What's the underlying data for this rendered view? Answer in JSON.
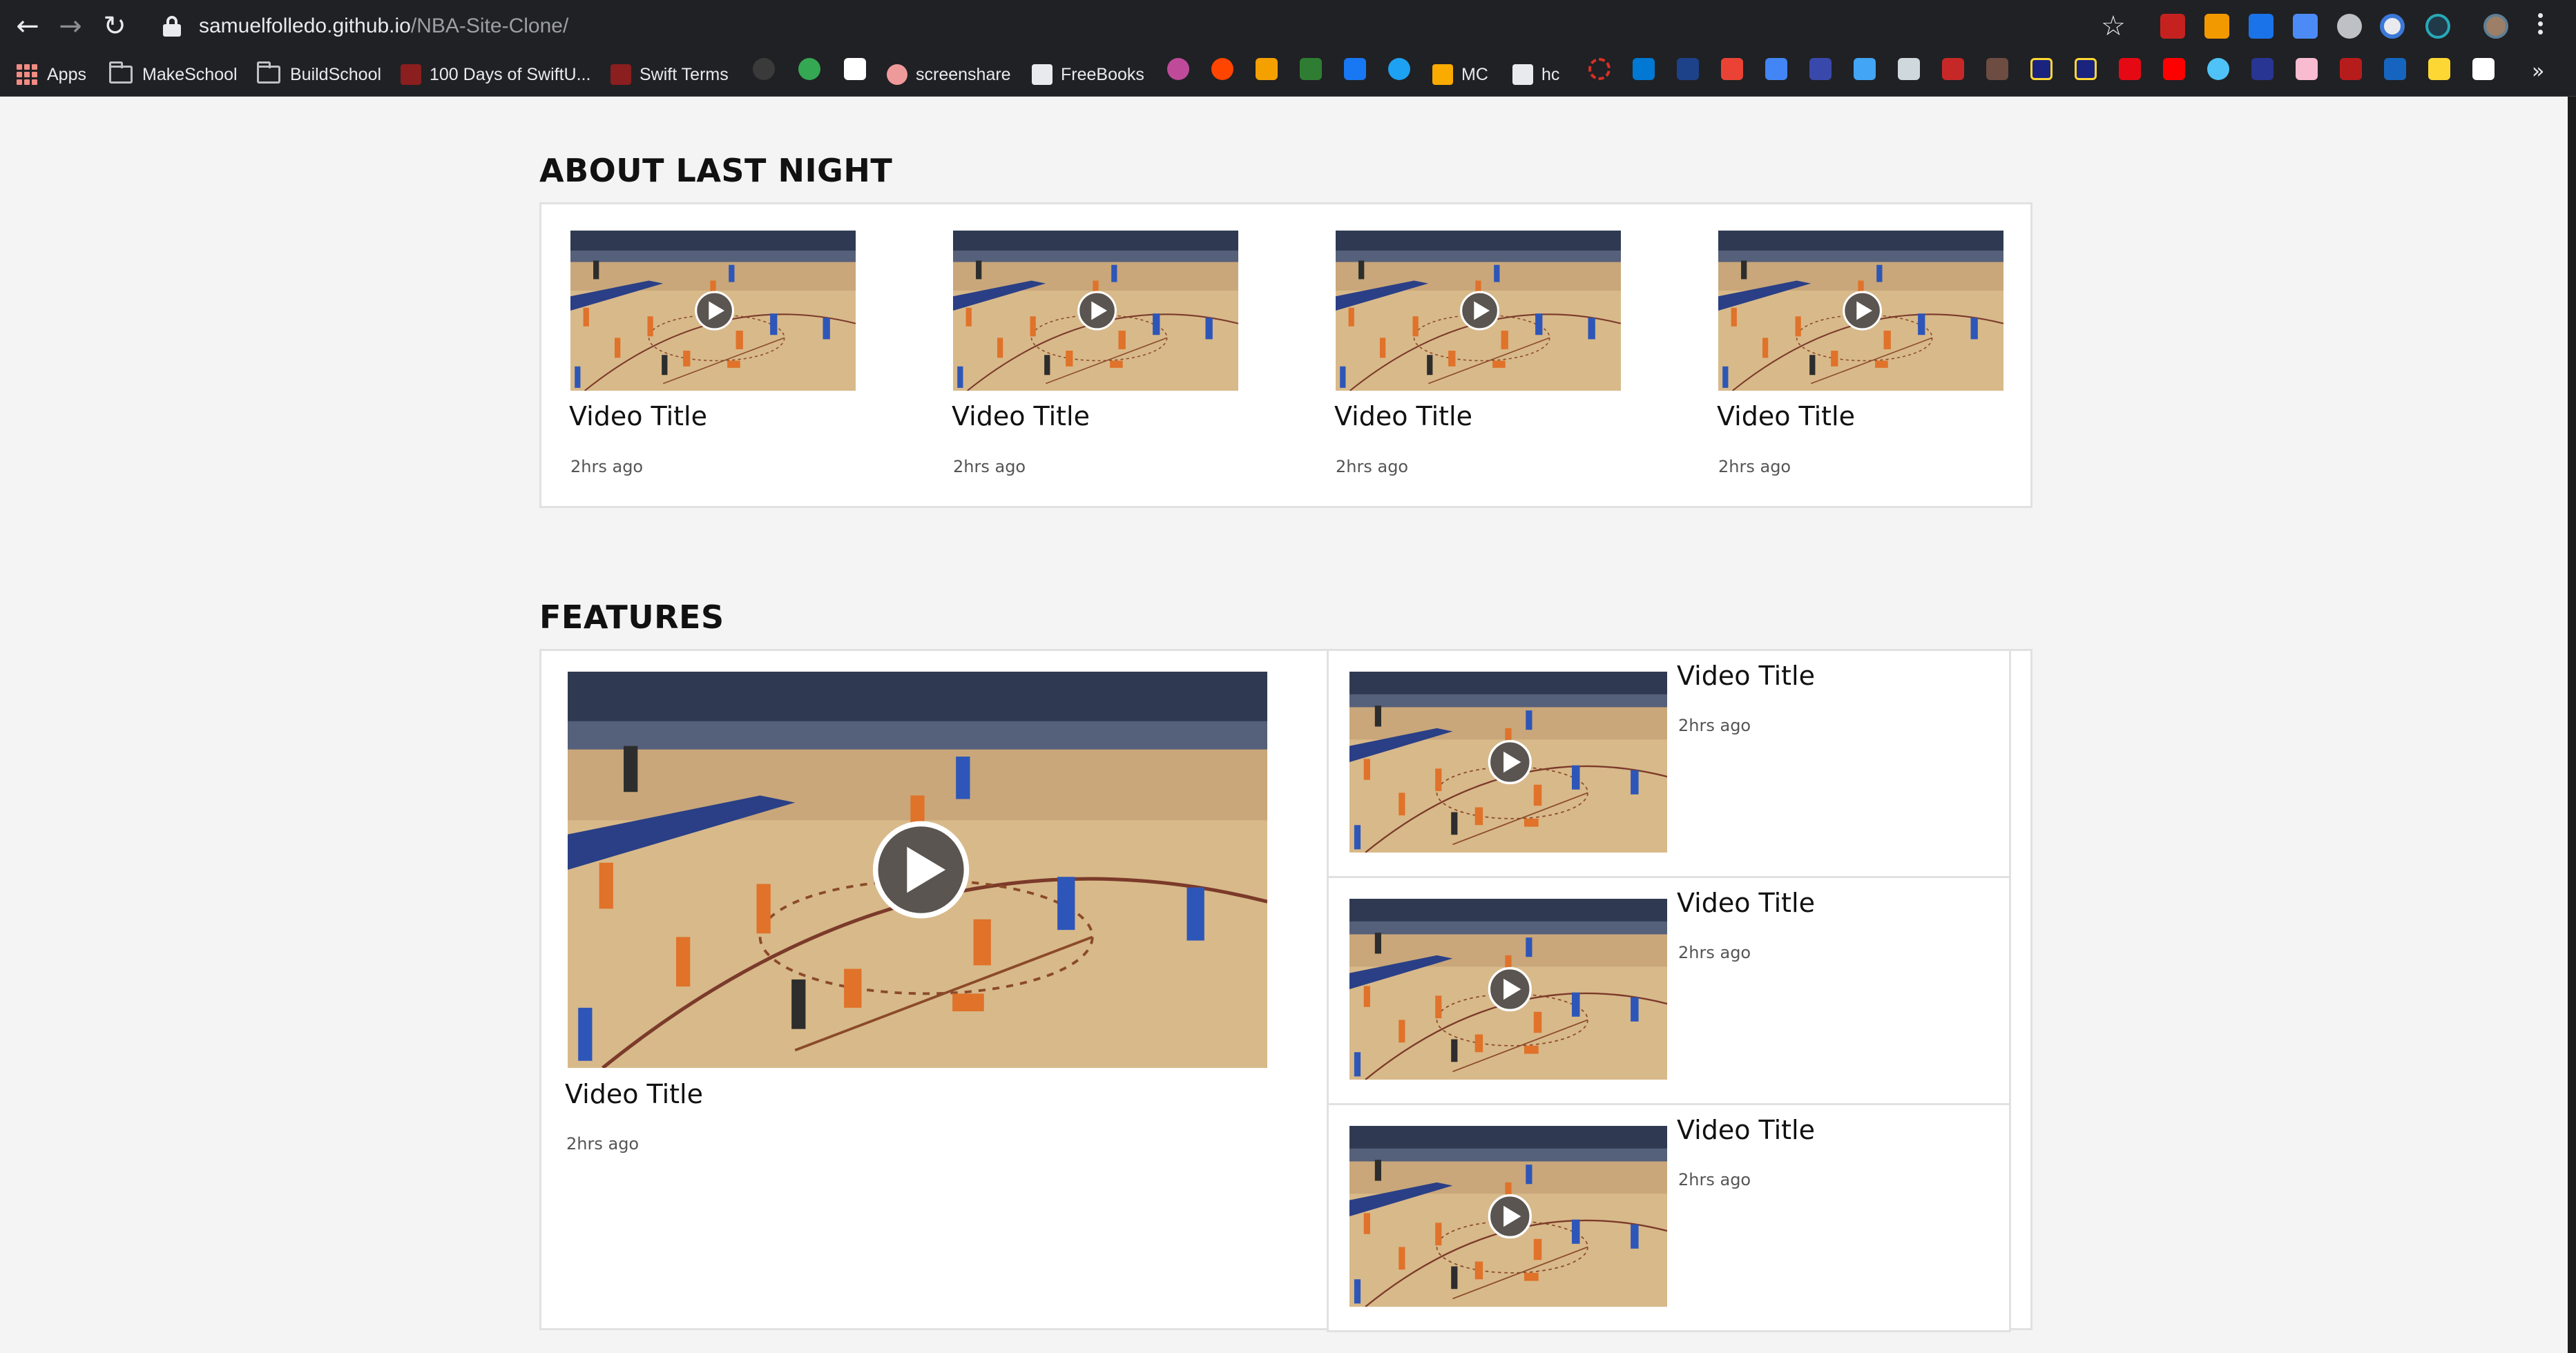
{
  "browser": {
    "url_host": "samuelfolledo.github.io",
    "url_path": "/NBA-Site-Clone/",
    "bookmarks": [
      {
        "label": "Apps"
      },
      {
        "label": "MakeSchool"
      },
      {
        "label": "BuildSchool"
      },
      {
        "label": "100 Days of SwiftU..."
      },
      {
        "label": "Swift Terms"
      },
      {
        "label": "screenshare"
      },
      {
        "label": "FreeBooks"
      },
      {
        "label": "MC"
      },
      {
        "label": "hc"
      }
    ],
    "overflow_icon": "chevron-double-right-icon"
  },
  "sections": {
    "about_last_night": {
      "title": "ABOUT LAST NIGHT",
      "videos": [
        {
          "title": "Video Title",
          "time": "2hrs ago"
        },
        {
          "title": "Video Title",
          "time": "2hrs ago"
        },
        {
          "title": "Video Title",
          "time": "2hrs ago"
        },
        {
          "title": "Video Title",
          "time": "2hrs ago"
        }
      ]
    },
    "features": {
      "title": "FEATURES",
      "main": {
        "title": "Video Title",
        "time": "2hrs ago"
      },
      "side": [
        {
          "title": "Video Title",
          "time": "2hrs ago"
        },
        {
          "title": "Video Title",
          "time": "2hrs ago"
        },
        {
          "title": "Video Title",
          "time": "2hrs ago"
        }
      ]
    }
  },
  "colors": {
    "court": "#d8b98a",
    "stands": "#2f3a52",
    "banner": "#1f3f86",
    "jersey_orange": "#e0722a",
    "jersey_blue": "#2d56b8",
    "play_button": "#5a5550"
  }
}
